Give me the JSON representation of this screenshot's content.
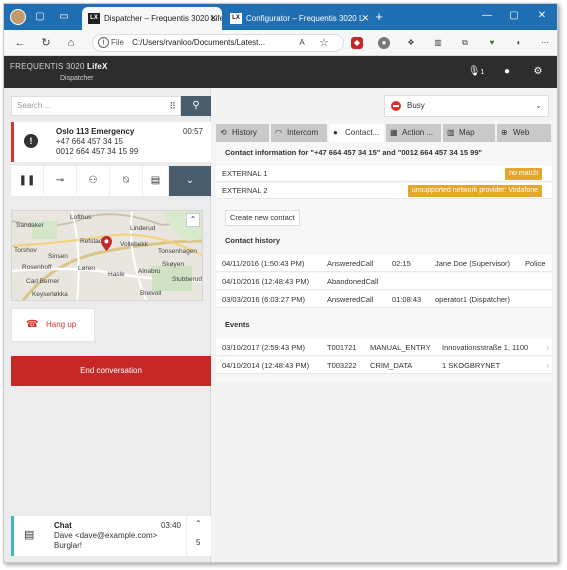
{
  "browser": {
    "tabs": [
      {
        "label": "Dispatcher – Frequentis 3020 Life",
        "active": true
      },
      {
        "label": "Configurator – Frequentis 3020 L",
        "active": false
      }
    ],
    "url_scheme": "File",
    "url_path": "C:/Users/rvanloo/Documents/Latest...",
    "window_controls": [
      "minimize",
      "maximize",
      "close"
    ]
  },
  "app": {
    "brand_prefix": "FREQUENTIS 3020 ",
    "brand_strong": "LifeX",
    "brand_sub": "Dispatcher",
    "mic_count": "1"
  },
  "left": {
    "search_placeholder": "Search ...",
    "call": {
      "title": "Oslo 113 Emergency",
      "time": "00:57",
      "number1": "+47 664 457 34 15",
      "number2": "0012 664 457 34 15 99"
    },
    "map_labels": [
      "Sandaker",
      "Lofthus",
      "Linderud",
      "Refstad",
      "Vollebekk",
      "Torshov",
      "Sinsen",
      "Rosenhoff",
      "Løren",
      "Hasle",
      "Carl Berner",
      "Tonsenhagen",
      "Keyserløkka",
      "Alnabru",
      "Stubberud",
      "Breivoll",
      "Skøyen"
    ],
    "hangup_label": "Hang up",
    "end_label": "End conversation",
    "chat": {
      "title": "Chat",
      "time": "03:40",
      "from": "Dave <dave@example.com>",
      "message": "Burglar!",
      "count": "5"
    }
  },
  "right": {
    "status": "Busy",
    "tabs": [
      "History",
      "Intercom",
      "Contact...",
      "Action ...",
      "Map",
      "Web"
    ],
    "active_tab": "Contact...",
    "contact_info_heading": "Contact information for \"+47 664 457 34 15\" and \"0012 664 457 34 15 99\"",
    "externals": [
      {
        "name": "EXTERNAL 1",
        "badge": "no match"
      },
      {
        "name": "EXTERNAL 2",
        "badge": "unsupported network provider: Vodafone"
      }
    ],
    "create_contact_label": "Create new contact",
    "history_title": "Contact history",
    "history": [
      {
        "date": "04/11/2016 (1:50:43 PM)",
        "type": "AnsweredCall",
        "duration": "02:15",
        "agent": "Jane Doe (Supervisor)",
        "org": "Police"
      },
      {
        "date": "04/10/2016 (12:48:43 PM)",
        "type": "AbandonedCall",
        "duration": "",
        "agent": "",
        "org": ""
      },
      {
        "date": "03/03/2016 (6:03:27 PM)",
        "type": "AnsweredCall",
        "duration": "01:08:43",
        "agent": "operator1 (Dispatcher)",
        "org": ""
      }
    ],
    "events_title": "Events",
    "events": [
      {
        "date": "03/10/2017 (2:59:43 PM)",
        "id": "T001721",
        "source": "MANUAL_ENTRY",
        "address": "Innovationsstraße 1, 1100"
      },
      {
        "date": "04/10/2014 (12:48:43 PM)",
        "id": "T003222",
        "source": "CRIM_DATA",
        "address": "1 SKOGBRYNET"
      }
    ]
  },
  "colors": {
    "tabbar": "#1f6fb2",
    "app_header": "#2d2d2d",
    "emergency_red": "#c62828",
    "badge_orange": "#e3a62e",
    "control_slate": "#4a5d6c",
    "chat_accent": "#3cb6c9"
  },
  "icons": [
    "avatar-icon",
    "workspaces-icon",
    "tab-actions-icon",
    "lx-tab-icon",
    "close-icon",
    "new-tab-icon",
    "back-icon",
    "refresh-icon",
    "home-icon",
    "info-icon",
    "read-aloud-icon",
    "favorite-icon",
    "microphone-icon",
    "user-icon",
    "gear-icon",
    "dialpad-icon",
    "search-icon",
    "warning-icon",
    "pause-icon",
    "transfer-icon",
    "conference-icon",
    "mute-icon",
    "message-icon",
    "chevron-down-icon",
    "map-marker-icon",
    "phone-hangup-icon",
    "chat-icon",
    "busy-icon"
  ]
}
